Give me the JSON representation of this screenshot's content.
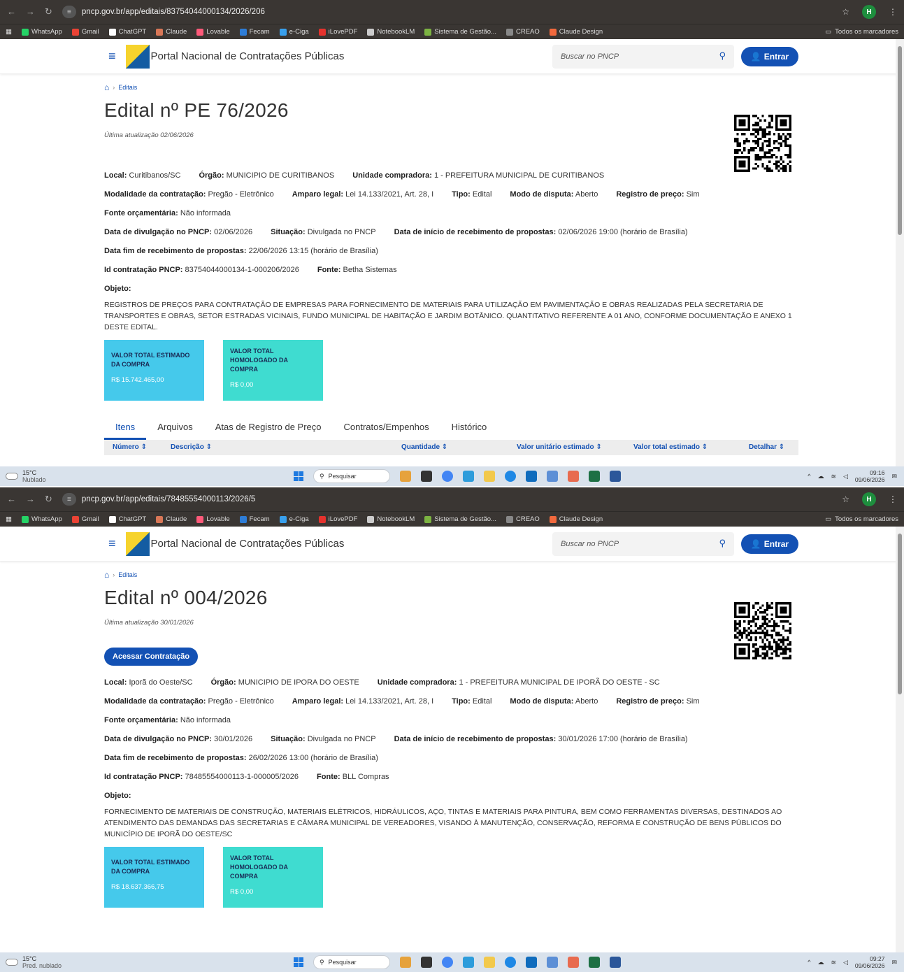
{
  "browser": {
    "bookmarks": [
      "WhatsApp",
      "Gmail",
      "ChatGPT",
      "Claude",
      "Lovable",
      "Fecam",
      "e-Ciga",
      "iLovePDF",
      "NotebookLM",
      "Sistema de Gestão...",
      "CREAO",
      "Claude Design"
    ],
    "all_bookmarks": "Todos os marcadores",
    "profile_initial": "H"
  },
  "portal": {
    "title": "Portal Nacional de Contratações Públicas",
    "search_placeholder": "Buscar no PNCP",
    "login_label": "Entrar",
    "breadcrumb": "Editais",
    "accent": "#1351b4"
  },
  "screens": [
    {
      "url": "pncp.gov.br/app/editais/83754044000134/2026/206",
      "title": "Edital nº PE 76/2026",
      "updated": "Última atualização 02/06/2026",
      "lines": [
        [
          {
            "k": "Local:",
            "v": "Curitibanos/SC"
          },
          {
            "k": "Órgão:",
            "v": "MUNICIPIO DE CURITIBANOS"
          },
          {
            "k": "Unidade compradora:",
            "v": "1 - PREFEITURA MUNICIPAL DE CURITIBANOS"
          }
        ],
        [
          {
            "k": "Modalidade da contratação:",
            "v": "Pregão - Eletrônico"
          },
          {
            "k": "Amparo legal:",
            "v": "Lei 14.133/2021, Art. 28, I"
          },
          {
            "k": "Tipo:",
            "v": "Edital"
          },
          {
            "k": "Modo de disputa:",
            "v": "Aberto"
          },
          {
            "k": "Registro de preço:",
            "v": "Sim"
          }
        ],
        [
          {
            "k": "Fonte orçamentária:",
            "v": "Não informada"
          }
        ],
        [
          {
            "k": "Data de divulgação no PNCP:",
            "v": "02/06/2026"
          },
          {
            "k": "Situação:",
            "v": "Divulgada no PNCP"
          },
          {
            "k": "Data de início de recebimento de propostas:",
            "v": "02/06/2026 19:00 (horário de Brasília)"
          }
        ],
        [
          {
            "k": "Data fim de recebimento de propostas:",
            "v": "22/06/2026 13:15 (horário de Brasília)"
          }
        ],
        [
          {
            "k": "Id contratação PNCP:",
            "v": "83754044000134-1-000206/2026"
          },
          {
            "k": "Fonte:",
            "v": "Betha Sistemas"
          }
        ],
        [
          {
            "k": "Objeto:",
            "v": ""
          }
        ]
      ],
      "objeto": "REGISTROS DE PREÇOS PARA CONTRATAÇÃO DE EMPRESAS PARA FORNECIMENTO DE MATERIAIS PARA UTILIZAÇÃO EM PAVIMENTAÇÃO E OBRAS REALIZADAS PELA SECRETARIA DE TRANSPORTES E OBRAS, SETOR ESTRADAS VICINAIS, FUNDO MUNICIPAL DE HABITAÇÃO E JARDIM BOTÂNICO. QUANTITATIVO REFERENTE A 01 ANO, CONFORME DOCUMENTAÇÃO E ANEXO 1 DESTE EDITAL.",
      "card1_label": "VALOR TOTAL ESTIMADO DA COMPRA",
      "card1_value": "R$ 15.742.465,00",
      "card2_label": "VALOR TOTAL HOMOLOGADO DA COMPRA",
      "card2_value": "R$ 0,00",
      "tabs": [
        "Itens",
        "Arquivos",
        "Atas de Registro de Preço",
        "Contratos/Empenhos",
        "Histórico"
      ],
      "table_headers": [
        "Número",
        "Descrição",
        "Quantidade",
        "Valor unitário estimado",
        "Valor total estimado",
        "Detalhar"
      ],
      "weather_temp": "15°C",
      "weather_desc": "Nublado",
      "time": "09:16",
      "date": "09/06/2026",
      "taskbar_search": "Pesquisar"
    },
    {
      "url": "pncp.gov.br/app/editais/78485554000113/2026/5",
      "title": "Edital nº 004/2026",
      "updated": "Última atualização 30/01/2026",
      "access_label": "Acessar Contratação",
      "lines": [
        [
          {
            "k": "Local:",
            "v": "Iporã do Oeste/SC"
          },
          {
            "k": "Órgão:",
            "v": "MUNICIPIO DE IPORA DO OESTE"
          },
          {
            "k": "Unidade compradora:",
            "v": "1 - PREFEITURA MUNICIPAL DE IPORÃ DO OESTE - SC"
          }
        ],
        [
          {
            "k": "Modalidade da contratação:",
            "v": "Pregão - Eletrônico"
          },
          {
            "k": "Amparo legal:",
            "v": "Lei 14.133/2021, Art. 28, I"
          },
          {
            "k": "Tipo:",
            "v": "Edital"
          },
          {
            "k": "Modo de disputa:",
            "v": "Aberto"
          },
          {
            "k": "Registro de preço:",
            "v": "Sim"
          }
        ],
        [
          {
            "k": "Fonte orçamentária:",
            "v": "Não informada"
          }
        ],
        [
          {
            "k": "Data de divulgação no PNCP:",
            "v": "30/01/2026"
          },
          {
            "k": "Situação:",
            "v": "Divulgada no PNCP"
          },
          {
            "k": "Data de início de recebimento de propostas:",
            "v": "30/01/2026 17:00 (horário de Brasília)"
          }
        ],
        [
          {
            "k": "Data fim de recebimento de propostas:",
            "v": "26/02/2026 13:00 (horário de Brasília)"
          }
        ],
        [
          {
            "k": "Id contratação PNCP:",
            "v": "78485554000113-1-000005/2026"
          },
          {
            "k": "Fonte:",
            "v": "BLL Compras"
          }
        ],
        [
          {
            "k": "Objeto:",
            "v": ""
          }
        ]
      ],
      "objeto": "FORNECIMENTO DE MATERIAIS DE CONSTRUÇÃO, MATERIAIS ELÉTRICOS, HIDRÁULICOS, AÇO, TINTAS E MATERIAIS PARA PINTURA, BEM COMO FERRAMENTAS DIVERSAS, DESTINADOS AO ATENDIMENTO DAS DEMANDAS DAS SECRETARIAS E CÂMARA MUNICIPAL DE VEREADORES, VISANDO À MANUTENÇÃO, CONSERVAÇÃO, REFORMA E CONSTRUÇÃO DE BENS PÚBLICOS DO MUNICÍPIO DE IPORÃ DO OESTE/SC",
      "card1_label": "VALOR TOTAL ESTIMADO DA COMPRA",
      "card1_value": "R$ 18.637.366,75",
      "card2_label": "VALOR TOTAL HOMOLOGADO DA COMPRA",
      "card2_value": "R$ 0,00",
      "weather_temp": "15°C",
      "weather_desc": "Pred. nublado",
      "time": "09:27",
      "date": "09/06/2026",
      "taskbar_search": "Pesquisar"
    }
  ]
}
